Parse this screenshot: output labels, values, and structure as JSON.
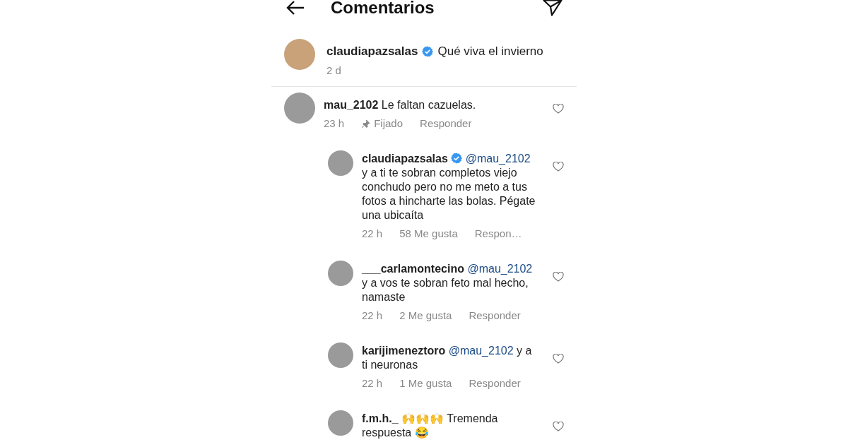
{
  "header": {
    "title": "Comentarios"
  },
  "caption": {
    "user": "claudiapazsalas",
    "verified": true,
    "text": "Qué viva el invierno",
    "time": "2 d"
  },
  "comments": [
    {
      "kind": "comment",
      "user": "mau_2102",
      "verified": false,
      "text": "Le faltan cazuelas.",
      "time": "23 h",
      "pinned": "Fijado",
      "reply": "Responder"
    },
    {
      "kind": "reply",
      "user": "claudiapazsalas",
      "verified": true,
      "mention": "@mau_2102",
      "text": "y a ti te sobran completos viejo conchudo pero no me meto a tus fotos a hincharte las bolas. Pégate una ubicaíta",
      "time": "22 h",
      "likes": "58 Me gusta",
      "reply": "Respon…"
    },
    {
      "kind": "reply",
      "user": "___carlamontecino",
      "verified": false,
      "mention": "@mau_2102",
      "text": "y a vos te sobran feto mal hecho, namaste",
      "time": "22 h",
      "likes": "2 Me gusta",
      "reply": "Responder"
    },
    {
      "kind": "reply",
      "user": "karijimeneztoro",
      "verified": false,
      "mention": "@mau_2102",
      "text": "y a ti neuronas",
      "time": "22 h",
      "likes": "1 Me gusta",
      "reply": "Responder"
    },
    {
      "kind": "reply",
      "user": "f.m.h._",
      "verified": false,
      "text": "🙌🙌🙌 Tremenda respuesta 😂"
    }
  ]
}
